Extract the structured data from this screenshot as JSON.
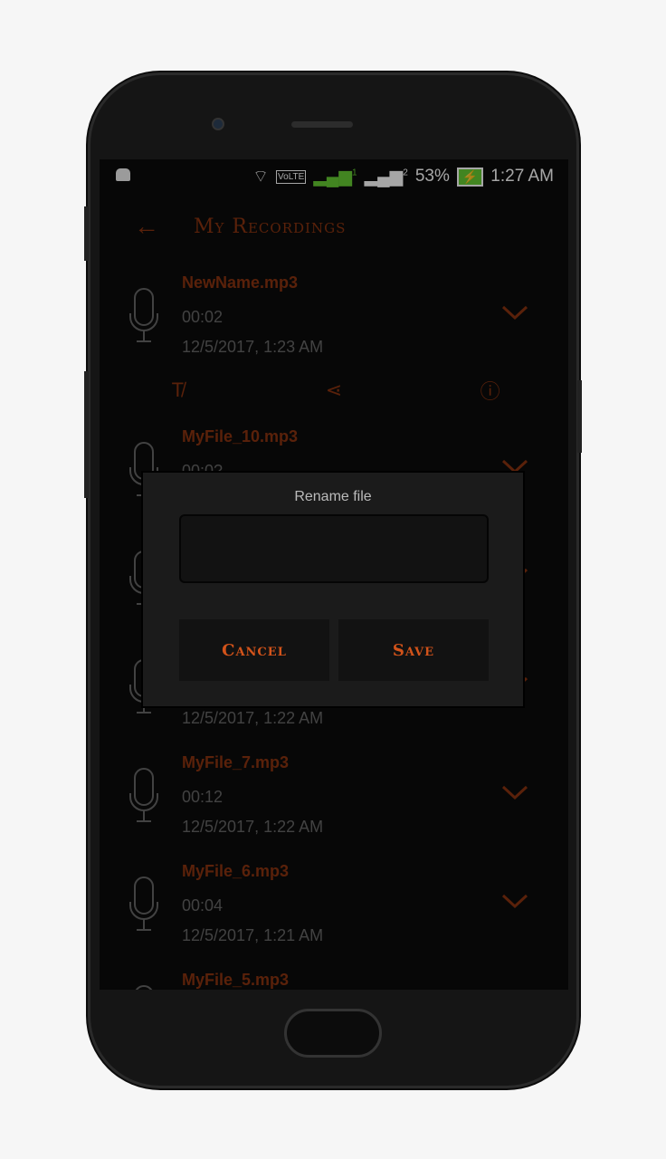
{
  "status": {
    "battery": "53%",
    "time": "1:27 AM",
    "sim1": "1",
    "sim2": "2",
    "volte": "VoLTE"
  },
  "appbar": {
    "title": "My Recordings",
    "back_icon": "arrow-left-icon"
  },
  "recordings": [
    {
      "name": "NewName.mp3",
      "duration": "00:02",
      "date": "12/5/2017, 1:23 AM",
      "expanded": true
    },
    {
      "name": "MyFile_10.mp3",
      "duration": "00:0?",
      "date": ""
    },
    {
      "name": "",
      "duration": "",
      "date": ""
    },
    {
      "name": "",
      "duration": "",
      "date": "12/5/2017, 1:22 AM"
    },
    {
      "name": "MyFile_7.mp3",
      "duration": "00:12",
      "date": "12/5/2017, 1:22 AM"
    },
    {
      "name": "MyFile_6.mp3",
      "duration": "00:04",
      "date": "12/5/2017, 1:21 AM"
    },
    {
      "name": "MyFile_5.mp3",
      "duration": "",
      "date": ""
    }
  ],
  "actions": [
    "rename-icon",
    "share-icon",
    "info-icon"
  ],
  "dialog": {
    "title": "Rename file",
    "input_value": "",
    "cancel": "Cancel",
    "save": "Save"
  },
  "colors": {
    "accent": "#d2531a",
    "dim_accent": "#8a3410",
    "bg": "#0c0c0c"
  }
}
